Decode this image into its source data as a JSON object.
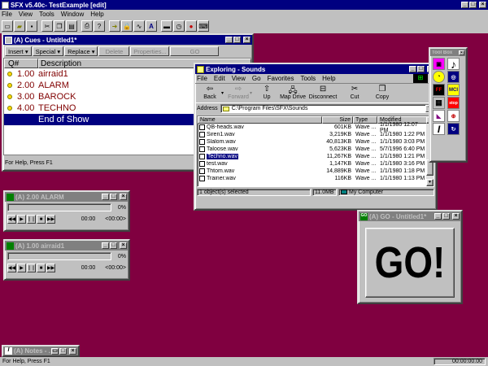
{
  "app": {
    "title": "SFX v5.40c- TestExample [edit]",
    "menu": [
      "File",
      "View",
      "Tools",
      "Window",
      "Help"
    ],
    "status_left": "For Help, Press F1",
    "status_right": "00:00:00.00"
  },
  "colors": {
    "desktop": "#800040",
    "titlebar_active": "#000080",
    "titlebar_inactive": "#808080",
    "cue_text": "#800000",
    "selection": "#000080"
  },
  "cues": {
    "title": "(A) Cues - Untitled1*",
    "toolbar": {
      "insert": "Insert",
      "special": "Special",
      "replace": "Replace",
      "delete": "Delete",
      "properties": "Properties...",
      "go": "GO"
    },
    "headers": {
      "q": "Q#",
      "desc": "Description"
    },
    "rows": [
      {
        "q": "1.00",
        "desc": "airraid1"
      },
      {
        "q": "2.00",
        "desc": "ALARM"
      },
      {
        "q": "3.00",
        "desc": "BAROCK"
      },
      {
        "q": "4.00",
        "desc": "TECHNO"
      }
    ],
    "end_row": "End of Show",
    "status": "For Help, Press F1"
  },
  "explorer": {
    "title": "Exploring - Sounds",
    "menu": [
      "File",
      "Edit",
      "View",
      "Go",
      "Favorites",
      "Tools",
      "Help"
    ],
    "toolbar": {
      "back": "Back",
      "forward": "Forward",
      "up": "Up",
      "map": "Map Drive",
      "disconnect": "Disconnect",
      "cut": "Cut",
      "copy": "Copy"
    },
    "address_label": "Address",
    "address": "C:\\Program Files\\SFX\\Sounds",
    "columns": {
      "name": "Name",
      "size": "Size",
      "type": "Type",
      "modified": "Modified"
    },
    "files": [
      {
        "name": "QB-heads.wav",
        "size": "601KB",
        "type": "Wave ...",
        "modified": "1/1/1980 12:07 PM"
      },
      {
        "name": "Siren1.wav",
        "size": "3,219KB",
        "type": "Wave ...",
        "modified": "1/1/1980 1:22 PM"
      },
      {
        "name": "Slalom.wav",
        "size": "40,813KB",
        "type": "Wave ...",
        "modified": "1/1/1980 3:03 PM"
      },
      {
        "name": "Taloose.wav",
        "size": "5,623KB",
        "type": "Wave ...",
        "modified": "5/7/1996 6:40 PM"
      },
      {
        "name": "Techno.wav",
        "size": "11,267KB",
        "type": "Wave ...",
        "modified": "1/1/1980 1:21 PM"
      },
      {
        "name": "test.wav",
        "size": "1,147KB",
        "type": "Wave ...",
        "modified": "1/1/1980 3:16 PM"
      },
      {
        "name": "Thtom.wav",
        "size": "14,889KB",
        "type": "Wave ...",
        "modified": "1/1/1980 1:18 PM"
      },
      {
        "name": "Trainer.wav",
        "size": "116KB",
        "type": "Wave ...",
        "modified": "1/1/1980 1:13 PM"
      }
    ],
    "selected_index": 4,
    "status_selected": "1 object(s) selected",
    "status_size": "11.0MB",
    "status_location": "My Computer"
  },
  "toolbox": {
    "title": "Tool Box"
  },
  "player_alarm": {
    "title": "(A) 2.00 ALARM",
    "percent": "0%",
    "time": "00:00",
    "remaining": "<00:00>"
  },
  "player_airraid": {
    "title": "(A) 1.00 airraid1",
    "percent": "0%",
    "time": "00:00",
    "remaining": "<00:00>"
  },
  "go_window": {
    "title": "(A) GO - Untitled1*",
    "label": "GO!"
  },
  "notes": {
    "title": "(A) Notes - ..."
  }
}
